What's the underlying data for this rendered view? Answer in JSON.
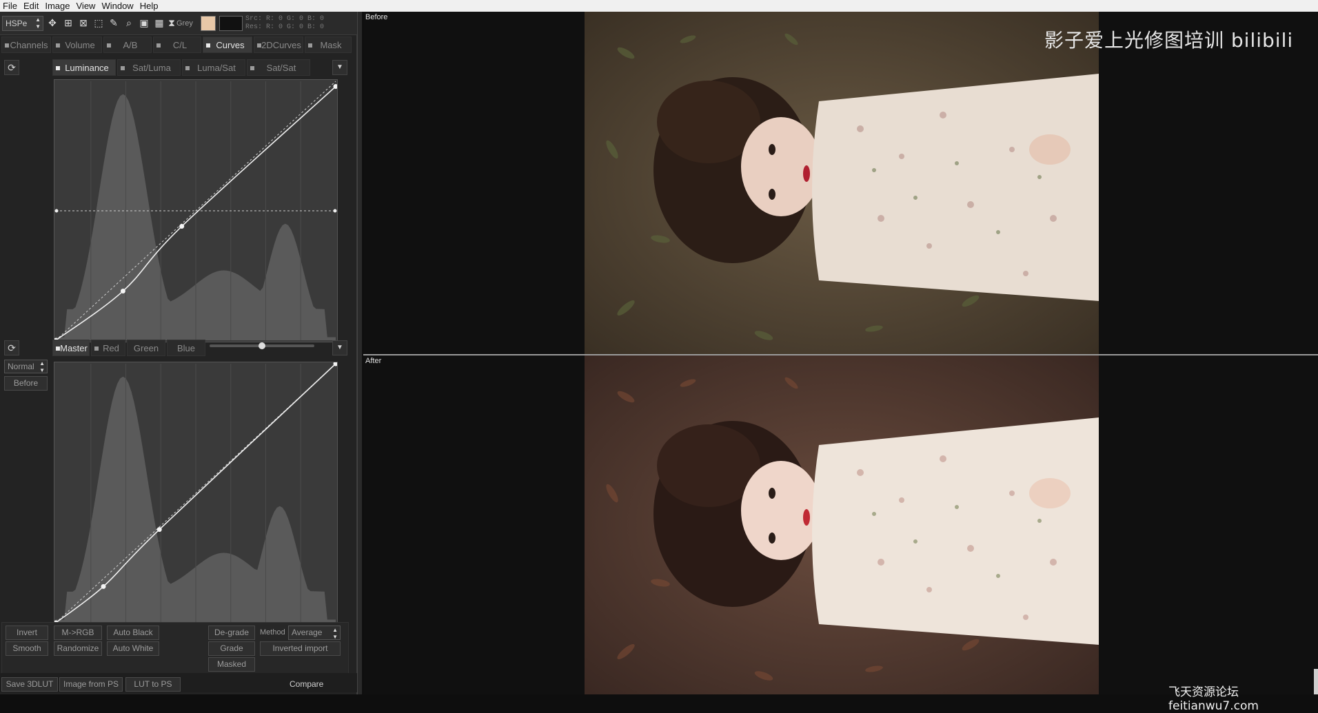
{
  "menu": [
    "File",
    "Edit",
    "Image",
    "View",
    "Window",
    "Help"
  ],
  "toolbar": {
    "mode": "HSPe",
    "grey_label": "Grey",
    "swatch_color": "#e8c8a8",
    "readout": {
      "line1": "Src: R:   0    G:   0    B:   0",
      "line2": "Res: R:   0    G:   0    B:   0"
    }
  },
  "tabs_main": [
    {
      "label": "Channels",
      "active": false
    },
    {
      "label": "Volume",
      "active": false
    },
    {
      "label": "A/B",
      "active": false
    },
    {
      "label": "C/L",
      "active": false
    },
    {
      "label": "Curves",
      "active": true
    },
    {
      "label": "2DCurves",
      "active": false
    },
    {
      "label": "Mask",
      "active": false
    }
  ],
  "tabs_curve_type": [
    {
      "label": "Luminance",
      "active": true
    },
    {
      "label": "Sat/Luma",
      "active": false
    },
    {
      "label": "Luma/Sat",
      "active": false
    },
    {
      "label": "Sat/Sat",
      "active": false
    }
  ],
  "tabs_channel": [
    {
      "label": "Master",
      "active": true
    },
    {
      "label": "Red",
      "active": false
    },
    {
      "label": "Green",
      "active": false
    },
    {
      "label": "Blue",
      "active": false
    }
  ],
  "blend_mode": "Normal",
  "before_button": "Before",
  "curves": {
    "luminance_points": [
      [
        0,
        0
      ],
      [
        0.24,
        0.19
      ],
      [
        0.45,
        0.44
      ],
      [
        1,
        0.98
      ]
    ],
    "master_points": [
      [
        0,
        0
      ],
      [
        0.17,
        0.14
      ],
      [
        0.37,
        0.36
      ],
      [
        1,
        1
      ]
    ],
    "slider_value": 0.5
  },
  "buttons_left": {
    "invert": "Invert",
    "m_rgb": "M->RGB",
    "auto_black": "Auto Black",
    "smooth": "Smooth",
    "randomize": "Randomize",
    "auto_white": "Auto White"
  },
  "buttons_right": {
    "degrade": "De-grade",
    "method_label": "Method",
    "method_value": "Average",
    "grade": "Grade",
    "inverted_import": "Inverted import",
    "masked": "Masked"
  },
  "bottom_bar": {
    "save_3dlut": "Save 3DLUT",
    "image_from_ps": "Image from PS",
    "lut_to_ps": "LUT to PS",
    "compare": "Compare"
  },
  "viewer": {
    "before_label": "Before",
    "after_label": "After",
    "watermark": "影子爱上光修图培训 bilibili",
    "watermark_bottom": "飞天资源论坛 feitianwu7.com"
  }
}
